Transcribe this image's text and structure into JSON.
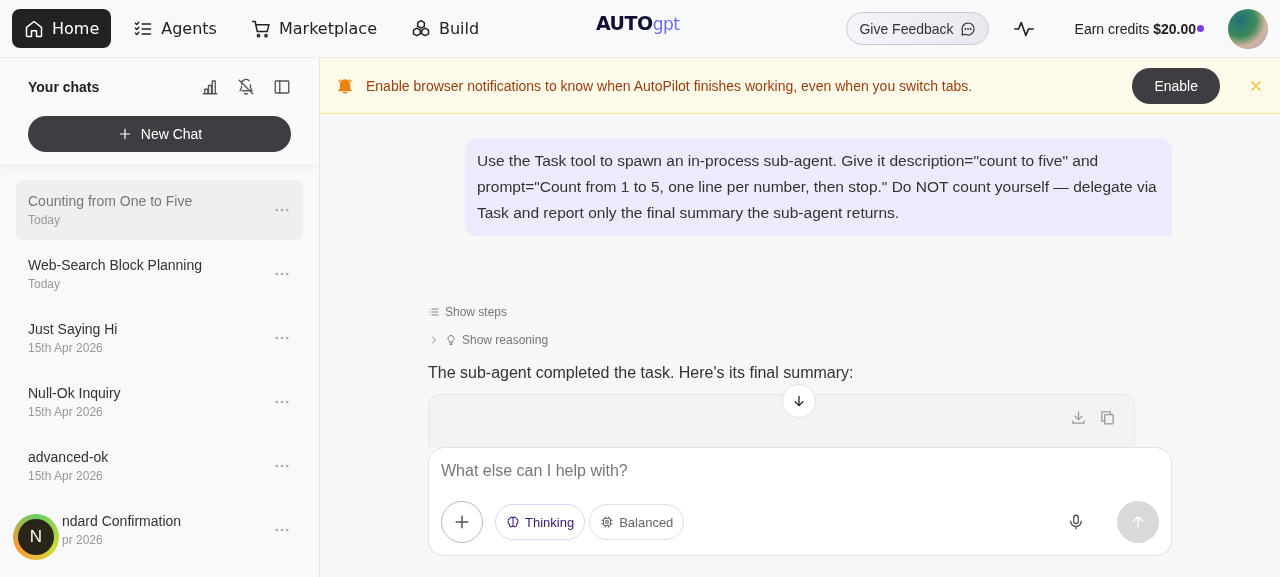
{
  "nav": {
    "tabs": [
      {
        "label": "Home",
        "selected": true
      },
      {
        "label": "Agents",
        "selected": false
      },
      {
        "label": "Marketplace",
        "selected": false
      },
      {
        "label": "Build",
        "selected": false
      }
    ],
    "logo": {
      "text": "AUTO",
      "accent": "gpt"
    },
    "feedback": "Give Feedback",
    "credits": {
      "label": "Earn credits",
      "amount": "$20.00"
    }
  },
  "sidebar": {
    "title": "Your chats",
    "new_chat": "New Chat",
    "items": [
      {
        "title": "Counting from One to Five",
        "date": "Today",
        "selected": true
      },
      {
        "title": "Web-Search Block Planning",
        "date": "Today",
        "selected": false
      },
      {
        "title": "Just Saying Hi",
        "date": "15th Apr 2026",
        "selected": false
      },
      {
        "title": "Null-Ok Inquiry",
        "date": "15th Apr 2026",
        "selected": false
      },
      {
        "title": "advanced-ok",
        "date": "15th Apr 2026",
        "selected": false
      },
      {
        "title": "ndard Confirmation",
        "date": "pr 2026",
        "selected": false
      }
    ],
    "badge": "N"
  },
  "banner": {
    "text": "Enable browser notifications to know when AutoPilot finishes working, even when you switch tabs.",
    "button": "Enable"
  },
  "thread": {
    "user_message": "Use the Task tool to spawn an in-process sub-agent. Give it description=\"count to five\" and prompt=\"Count from 1 to 5, one line per number, then stop.\" Do NOT count yourself — delegate via Task and report only the final summary the sub-agent returns.",
    "show_steps": "Show steps",
    "show_reasoning": "Show reasoning",
    "reply": "The sub-agent completed the task. Here's its final summary:"
  },
  "composer": {
    "placeholder": "What else can I help with?",
    "modes": [
      {
        "label": "Thinking",
        "selected": true
      },
      {
        "label": "Balanced",
        "selected": false
      }
    ]
  }
}
